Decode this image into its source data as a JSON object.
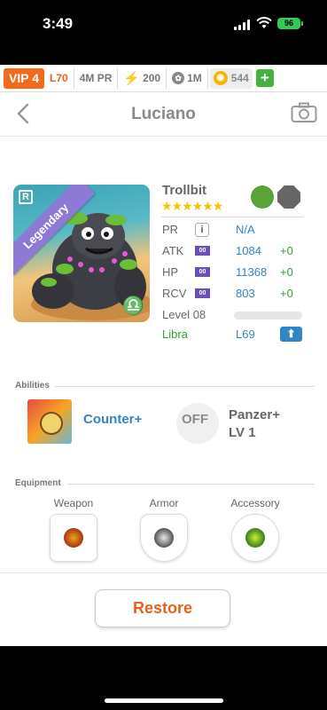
{
  "status": {
    "time": "3:49",
    "battery": "96"
  },
  "topbar": {
    "vip": "VIP 4",
    "level": "L70",
    "pr": "4M PR",
    "energy": "200",
    "pets": "1M",
    "coins": "544",
    "add_label": "+"
  },
  "nav": {
    "title": "Luciano"
  },
  "card": {
    "rarity": "Legendary",
    "badge": "R",
    "zodiac_symbol": "♎"
  },
  "monster": {
    "name": "Trollbit",
    "stars": "★★★★★★",
    "pr_label": "PR",
    "pr_info": "i",
    "pr_value": "N/A",
    "atk_label": "ATK",
    "atk_tag": "00",
    "atk_value": "1084",
    "atk_bonus": "+0",
    "hp_label": "HP",
    "hp_tag": "00",
    "hp_value": "11368",
    "hp_bonus": "+0",
    "rcv_label": "RCV",
    "rcv_tag": "00",
    "rcv_value": "803",
    "rcv_bonus": "+0",
    "level_label": "Level 08",
    "level_progress": 0,
    "sign_label": "Libra",
    "sign_value": "L69",
    "upgrade_icon": "⬆"
  },
  "abilities": {
    "header": "Abilities",
    "items": [
      {
        "name": "Counter+"
      },
      {
        "off_label": "OFF",
        "name_line1": "Panzer+",
        "name_line2": "LV 1"
      }
    ]
  },
  "equipment": {
    "header": "Equipment",
    "weapon_label": "Weapon",
    "armor_label": "Armor",
    "accessory_label": "Accessory"
  },
  "actions": {
    "restore_label": "Restore"
  },
  "colors": {
    "accent": "#e8631a",
    "link": "#2f86c7",
    "bonus": "#3a9a3a",
    "legendary": "#8e7ad6"
  },
  "icons": [
    "back-chevron-icon",
    "camera-icon",
    "leaf-element-icon",
    "rock-element-icon",
    "libra-icon",
    "upgrade-arrow-icon"
  ]
}
